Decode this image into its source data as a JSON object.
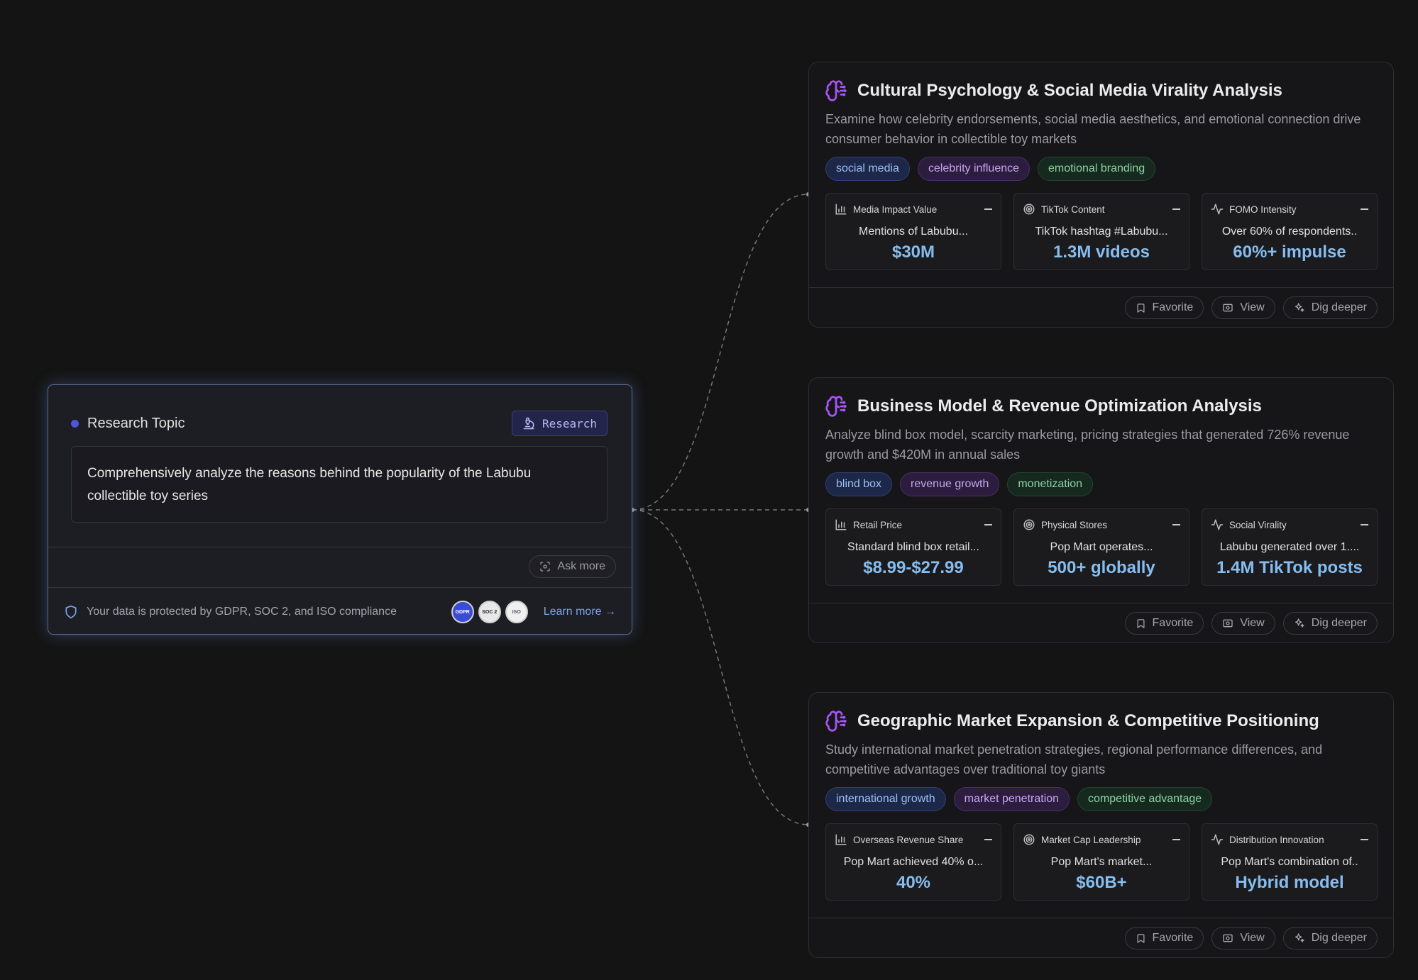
{
  "topic": {
    "label": "Research Topic",
    "research_button": "Research",
    "text": "Comprehensively analyze the reasons behind the popularity of the Labubu collectible toy series",
    "ask_more": "Ask more",
    "footer_text": "Your data is protected by GDPR, SOC 2, and ISO compliance",
    "badges": [
      "GDPR",
      "SOC 2",
      "ISO"
    ],
    "learn_more": "Learn more →"
  },
  "cards": [
    {
      "title": "Cultural Psychology & Social Media Virality Analysis",
      "desc": "Examine how celebrity endorsements, social media aesthetics, and emotional connection drive consumer behavior in collectible toy markets",
      "tags": [
        "social media",
        "celebrity influence",
        "emotional branding"
      ],
      "metrics": [
        {
          "name": "Media Impact Value",
          "desc": "Mentions of Labubu...",
          "value": "$30M",
          "icon": "bar-chart-icon"
        },
        {
          "name": "TikTok Content",
          "desc": "TikTok hashtag #Labubu...",
          "value": "1.3M videos",
          "icon": "target-icon"
        },
        {
          "name": "FOMO Intensity",
          "desc": "Over 60% of respondents..",
          "value": "60%+ impulse",
          "icon": "activity-icon"
        }
      ]
    },
    {
      "title": "Business Model & Revenue Optimization Analysis",
      "desc": "Analyze blind box model, scarcity marketing, pricing strategies that generated 726% revenue growth and $420M in annual sales",
      "tags": [
        "blind box",
        "revenue growth",
        "monetization"
      ],
      "metrics": [
        {
          "name": "Retail Price",
          "desc": "Standard blind box retail...",
          "value": "$8.99-$27.99",
          "icon": "bar-chart-icon"
        },
        {
          "name": "Physical Stores",
          "desc": "Pop Mart operates...",
          "value": "500+ globally",
          "icon": "target-icon"
        },
        {
          "name": "Social Virality",
          "desc": "Labubu generated over 1....",
          "value": "1.4M TikTok posts",
          "icon": "activity-icon"
        }
      ]
    },
    {
      "title": "Geographic Market Expansion & Competitive Positioning",
      "desc": "Study international market penetration strategies, regional performance differences, and competitive advantages over traditional toy giants",
      "tags": [
        "international growth",
        "market penetration",
        "competitive advantage"
      ],
      "metrics": [
        {
          "name": "Overseas Revenue Share",
          "desc": "Pop Mart achieved 40% o...",
          "value": "40%",
          "icon": "bar-chart-icon"
        },
        {
          "name": "Market Cap Leadership",
          "desc": "Pop Mart's market...",
          "value": "$60B+",
          "icon": "target-icon"
        },
        {
          "name": "Distribution Innovation",
          "desc": "Pop Mart's combination of..",
          "value": "Hybrid model",
          "icon": "activity-icon"
        }
      ]
    }
  ],
  "actions": {
    "favorite": "Favorite",
    "view": "View",
    "dig_deeper": "Dig deeper"
  },
  "colors": {
    "accent_blue": "#86bdf0",
    "brain_icon": "#a855f7",
    "topic_dot": "#4d55d8",
    "link": "#7ea4ec"
  }
}
